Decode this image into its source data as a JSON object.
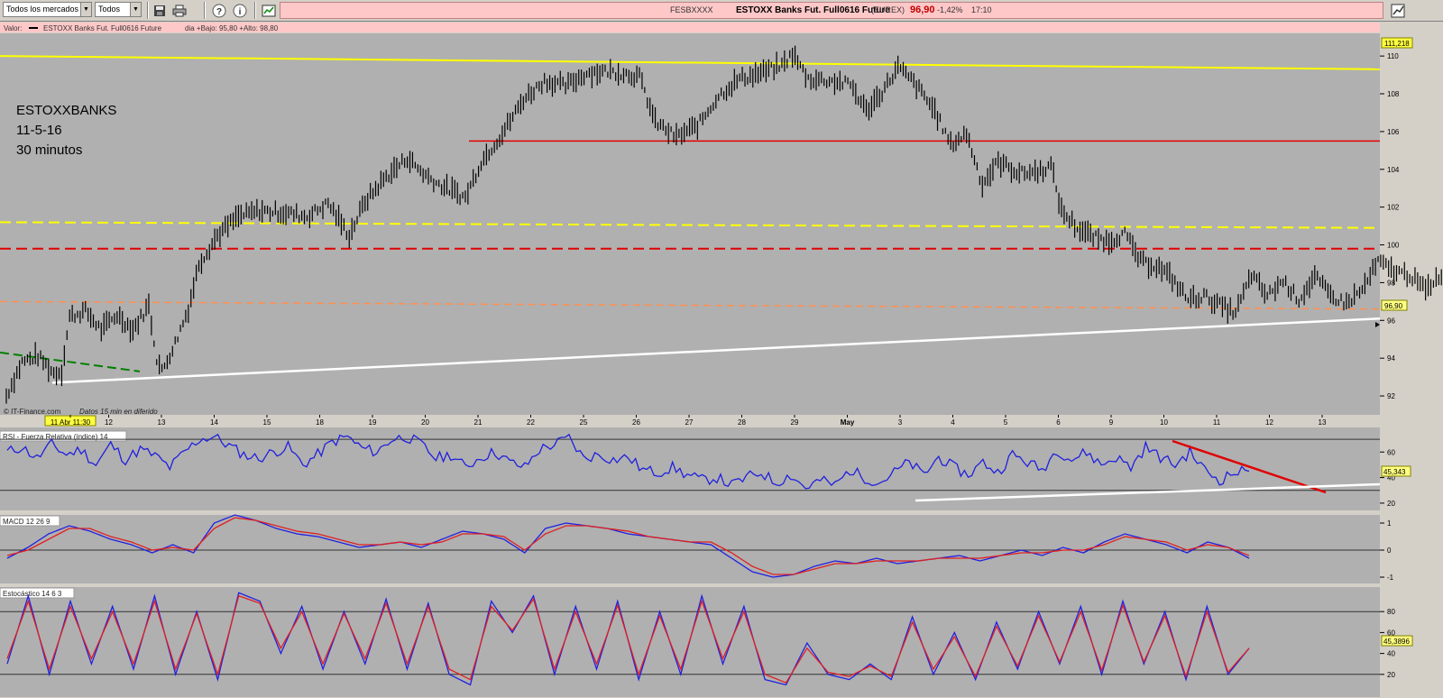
{
  "toolbar": {
    "market_select": "Todos los mercados",
    "filter_select": "Todos",
    "ticker_symbol": "FESBXXXX",
    "ticker_name": "ESTOXX Banks Fut. Full0616 Future",
    "ticker_exchange": "(EUREX)",
    "ticker_price": "96,90",
    "ticker_change": "-1,42%",
    "ticker_time": "17:10",
    "icons": [
      "save-icon",
      "print-icon",
      "help-icon",
      "info-icon",
      "window-icon",
      "chart-icon"
    ]
  },
  "main_panel": {
    "header": "Valor:",
    "legend_name": "ESTOXX Banks Fut. Full0616 Future",
    "legend_detail": "dia +Bajo: 95,80 +Alto: 98,80",
    "annotation_lines": [
      "ESTOXXBANKS",
      "11-5-16",
      "30 minutos"
    ],
    "source": "© IT-Finance.com",
    "delay_note": "Datos 15 min en diferido",
    "y_ticks": [
      "110",
      "108",
      "106",
      "104",
      "102",
      "100",
      "98",
      "96",
      "94",
      "92"
    ],
    "top_label": "111,218",
    "price_label": "96,90",
    "x_labels": [
      "11 Abr 11:30",
      "12",
      "13",
      "14",
      "15",
      "18",
      "19",
      "20",
      "21",
      "22",
      "25",
      "26",
      "27",
      "28",
      "29",
      "May",
      "3",
      "4",
      "5",
      "6",
      "9",
      "10",
      "11",
      "12",
      "13"
    ]
  },
  "rsi_panel": {
    "title": "RSI - Fuerza Relativa (índice) 14",
    "y_ticks": [
      "60",
      "40",
      "20"
    ],
    "value_label": "45,343"
  },
  "macd_panel": {
    "title": "MACD 12 26 9",
    "y_ticks": [
      "1",
      "0",
      "-1"
    ]
  },
  "stoch_panel": {
    "title": "Estocástico 14 6 3",
    "y_ticks": [
      "80",
      "60",
      "40",
      "20"
    ],
    "value_label": "45,3896"
  },
  "colors": {
    "panel_bg": "#b0b0b0",
    "resistance": "#e00000",
    "long_term": "#ffff00",
    "support": "#ffffff",
    "fast_line": "#2020e0",
    "slow_line": "#e02020"
  },
  "chart_data": [
    {
      "type": "candlestick",
      "title": "ESTOXX Banks Fut. Full0616 Future",
      "ylim": [
        91,
        111.2
      ],
      "x_categories": [
        "11 Abr",
        "12",
        "13",
        "14",
        "15",
        "18",
        "19",
        "20",
        "21",
        "22",
        "25",
        "26",
        "27",
        "28",
        "29",
        "May",
        "3",
        "4",
        "5",
        "6",
        "9",
        "10",
        "11",
        "12",
        "13"
      ],
      "price_path": [
        [
          0,
          92
        ],
        [
          0.3,
          93.8
        ],
        [
          0.6,
          94.1
        ],
        [
          0.9,
          93.2
        ],
        [
          1.05,
          93.3
        ],
        [
          1.2,
          96.2
        ],
        [
          1.5,
          96.5
        ],
        [
          1.8,
          95.5
        ],
        [
          2.1,
          96.3
        ],
        [
          2.4,
          95.5
        ],
        [
          2.7,
          96.8
        ],
        [
          2.85,
          94
        ],
        [
          2.95,
          93.3
        ],
        [
          3.2,
          94.8
        ],
        [
          3.45,
          96.6
        ],
        [
          3.65,
          99
        ],
        [
          4.0,
          100.5
        ],
        [
          4.4,
          101.5
        ],
        [
          4.8,
          101.8
        ],
        [
          5.3,
          101.7
        ],
        [
          5.7,
          101.5
        ],
        [
          6.1,
          102.2
        ],
        [
          6.5,
          100.5
        ],
        [
          6.8,
          102.3
        ],
        [
          7.2,
          103.6
        ],
        [
          7.6,
          104.6
        ],
        [
          7.9,
          103.8
        ],
        [
          8.2,
          103.2
        ],
        [
          8.7,
          102.5
        ],
        [
          9.0,
          104.4
        ],
        [
          9.4,
          105.9
        ],
        [
          9.8,
          107.7
        ],
        [
          10.2,
          108.7
        ],
        [
          10.6,
          108.4
        ],
        [
          11.0,
          109.1
        ],
        [
          11.4,
          109.2
        ],
        [
          11.7,
          109.1
        ],
        [
          12.0,
          108.9
        ],
        [
          12.3,
          106.5
        ],
        [
          12.7,
          105.7
        ],
        [
          13.1,
          106.3
        ],
        [
          13.5,
          107.9
        ],
        [
          13.9,
          108.8
        ],
        [
          14.3,
          109.1
        ],
        [
          14.7,
          109.5
        ],
        [
          14.9,
          110.1
        ],
        [
          15.2,
          108.8
        ],
        [
          15.6,
          108.7
        ],
        [
          16.0,
          108.5
        ],
        [
          16.3,
          107.1
        ],
        [
          16.6,
          108.1
        ],
        [
          16.9,
          109.4
        ],
        [
          17.2,
          108.6
        ],
        [
          17.6,
          107.1
        ],
        [
          17.9,
          105.3
        ],
        [
          18.2,
          105.9
        ],
        [
          18.5,
          103.2
        ],
        [
          18.8,
          104.4
        ],
        [
          19.2,
          103.8
        ],
        [
          19.6,
          103.9
        ],
        [
          19.8,
          104.2
        ],
        [
          20.0,
          101.8
        ],
        [
          20.3,
          100.9
        ],
        [
          20.6,
          100.4
        ],
        [
          20.9,
          100.2
        ],
        [
          21.2,
          100.6
        ],
        [
          21.5,
          99.1
        ],
        [
          21.8,
          98.9
        ],
        [
          22.1,
          98.2
        ],
        [
          22.4,
          97.1
        ],
        [
          22.7,
          97.3
        ],
        [
          23.0,
          96.8
        ],
        [
          23.3,
          96.4
        ],
        [
          23.6,
          98.4
        ],
        [
          23.9,
          97.3
        ],
        [
          24.2,
          98.1
        ],
        [
          24.5,
          97.1
        ],
        [
          24.8,
          98.3
        ],
        [
          25.1,
          97.3
        ],
        [
          25.4,
          96.9
        ],
        [
          25.7,
          97.6
        ],
        [
          26.0,
          99.1
        ],
        [
          26.3,
          98.6
        ],
        [
          26.6,
          98.4
        ],
        [
          26.9,
          97.6
        ],
        [
          27.2,
          98.5
        ],
        [
          27.5,
          97.1
        ],
        [
          27.8,
          96.8
        ],
        [
          28.1,
          96.1
        ],
        [
          28.4,
          97.0
        ],
        [
          28.7,
          96.9
        ]
      ],
      "lines": [
        {
          "name": "yellow-solid",
          "y": [
            110.0,
            109.3
          ]
        },
        {
          "name": "red-solid",
          "y": [
            105.5,
            105.5
          ]
        },
        {
          "name": "yellow-dashed",
          "y": [
            101.2,
            100.9
          ]
        },
        {
          "name": "red-dashed",
          "y": [
            99.8,
            99.8
          ]
        },
        {
          "name": "orange-dashed",
          "y": [
            97.0,
            96.6
          ]
        },
        {
          "name": "white-support",
          "y": [
            92.7,
            96.1
          ]
        },
        {
          "name": "green-dashed",
          "y": [
            94.3,
            93.3
          ]
        }
      ]
    },
    {
      "type": "line",
      "title": "RSI - Fuerza Relativa (índice) 14",
      "ylim": [
        15,
        75
      ],
      "series": [
        {
          "name": "RSI",
          "values": [
            60,
            64,
            55,
            66,
            58,
            62,
            50,
            66,
            54,
            62,
            57,
            48,
            60,
            70,
            72,
            65,
            58,
            55,
            60,
            64,
            50,
            58,
            68,
            72,
            63,
            60,
            70,
            72,
            66,
            55,
            58,
            48,
            56,
            60,
            52,
            48,
            62,
            66,
            71,
            55,
            58,
            54,
            56,
            46,
            44,
            48,
            42,
            38,
            40,
            34,
            40,
            44,
            36,
            42,
            32,
            38,
            34,
            46,
            40,
            36,
            44,
            52,
            42,
            56,
            48,
            42,
            52,
            44,
            58,
            52,
            46,
            62,
            54,
            60,
            50,
            56,
            48,
            64,
            56,
            50,
            60,
            46,
            38,
            44,
            45
          ]
        }
      ]
    },
    {
      "type": "line",
      "title": "MACD 12 26 9",
      "ylim": [
        -1.2,
        1.2
      ],
      "series": [
        {
          "name": "MACD",
          "values": [
            -0.3,
            0.1,
            0.6,
            0.9,
            0.7,
            0.4,
            0.2,
            -0.1,
            0.2,
            -0.1,
            1.0,
            1.3,
            1.1,
            0.8,
            0.6,
            0.5,
            0.3,
            0.1,
            0.2,
            0.3,
            0.1,
            0.4,
            0.7,
            0.6,
            0.4,
            -0.1,
            0.8,
            1.0,
            0.9,
            0.8,
            0.6,
            0.5,
            0.4,
            0.3,
            0.2,
            -0.3,
            -0.8,
            -1.0,
            -0.9,
            -0.6,
            -0.4,
            -0.5,
            -0.3,
            -0.5,
            -0.4,
            -0.3,
            -0.2,
            -0.4,
            -0.2,
            0.0,
            -0.2,
            0.1,
            -0.1,
            0.3,
            0.6,
            0.4,
            0.2,
            -0.1,
            0.3,
            0.1,
            -0.3
          ]
        },
        {
          "name": "Señal",
          "values": [
            -0.2,
            0.0,
            0.4,
            0.8,
            0.8,
            0.5,
            0.3,
            0.0,
            0.1,
            0.0,
            0.8,
            1.2,
            1.1,
            0.9,
            0.7,
            0.6,
            0.4,
            0.2,
            0.2,
            0.3,
            0.2,
            0.3,
            0.6,
            0.6,
            0.5,
            0.0,
            0.6,
            0.9,
            0.9,
            0.8,
            0.7,
            0.5,
            0.4,
            0.3,
            0.3,
            -0.1,
            -0.6,
            -0.9,
            -0.9,
            -0.7,
            -0.5,
            -0.5,
            -0.4,
            -0.4,
            -0.4,
            -0.3,
            -0.3,
            -0.3,
            -0.2,
            -0.1,
            -0.1,
            0.0,
            0.0,
            0.2,
            0.5,
            0.4,
            0.3,
            0.0,
            0.2,
            0.1,
            -0.2
          ]
        }
      ]
    },
    {
      "type": "line",
      "title": "Estocástico 14 6 3",
      "ylim": [
        0,
        100
      ],
      "series": [
        {
          "name": "%K",
          "values": [
            30,
            95,
            20,
            90,
            30,
            85,
            25,
            95,
            20,
            80,
            15,
            98,
            90,
            40,
            85,
            25,
            80,
            30,
            92,
            25,
            88,
            20,
            10,
            90,
            60,
            95,
            20,
            85,
            25,
            90,
            15,
            80,
            20,
            95,
            30,
            85,
            15,
            10,
            50,
            20,
            15,
            30,
            15,
            75,
            20,
            60,
            15,
            70,
            25,
            80,
            30,
            85,
            20,
            90,
            30,
            80,
            15,
            85,
            20,
            45
          ]
        },
        {
          "name": "%D",
          "values": [
            35,
            90,
            25,
            85,
            35,
            80,
            30,
            90,
            25,
            78,
            20,
            95,
            88,
            45,
            80,
            30,
            78,
            35,
            88,
            30,
            85,
            25,
            15,
            85,
            62,
            92,
            25,
            80,
            30,
            86,
            20,
            76,
            25,
            90,
            35,
            80,
            20,
            12,
            45,
            22,
            18,
            28,
            18,
            70,
            25,
            56,
            18,
            66,
            28,
            76,
            32,
            80,
            24,
            86,
            32,
            76,
            18,
            80,
            22,
            45
          ]
        }
      ]
    }
  ]
}
